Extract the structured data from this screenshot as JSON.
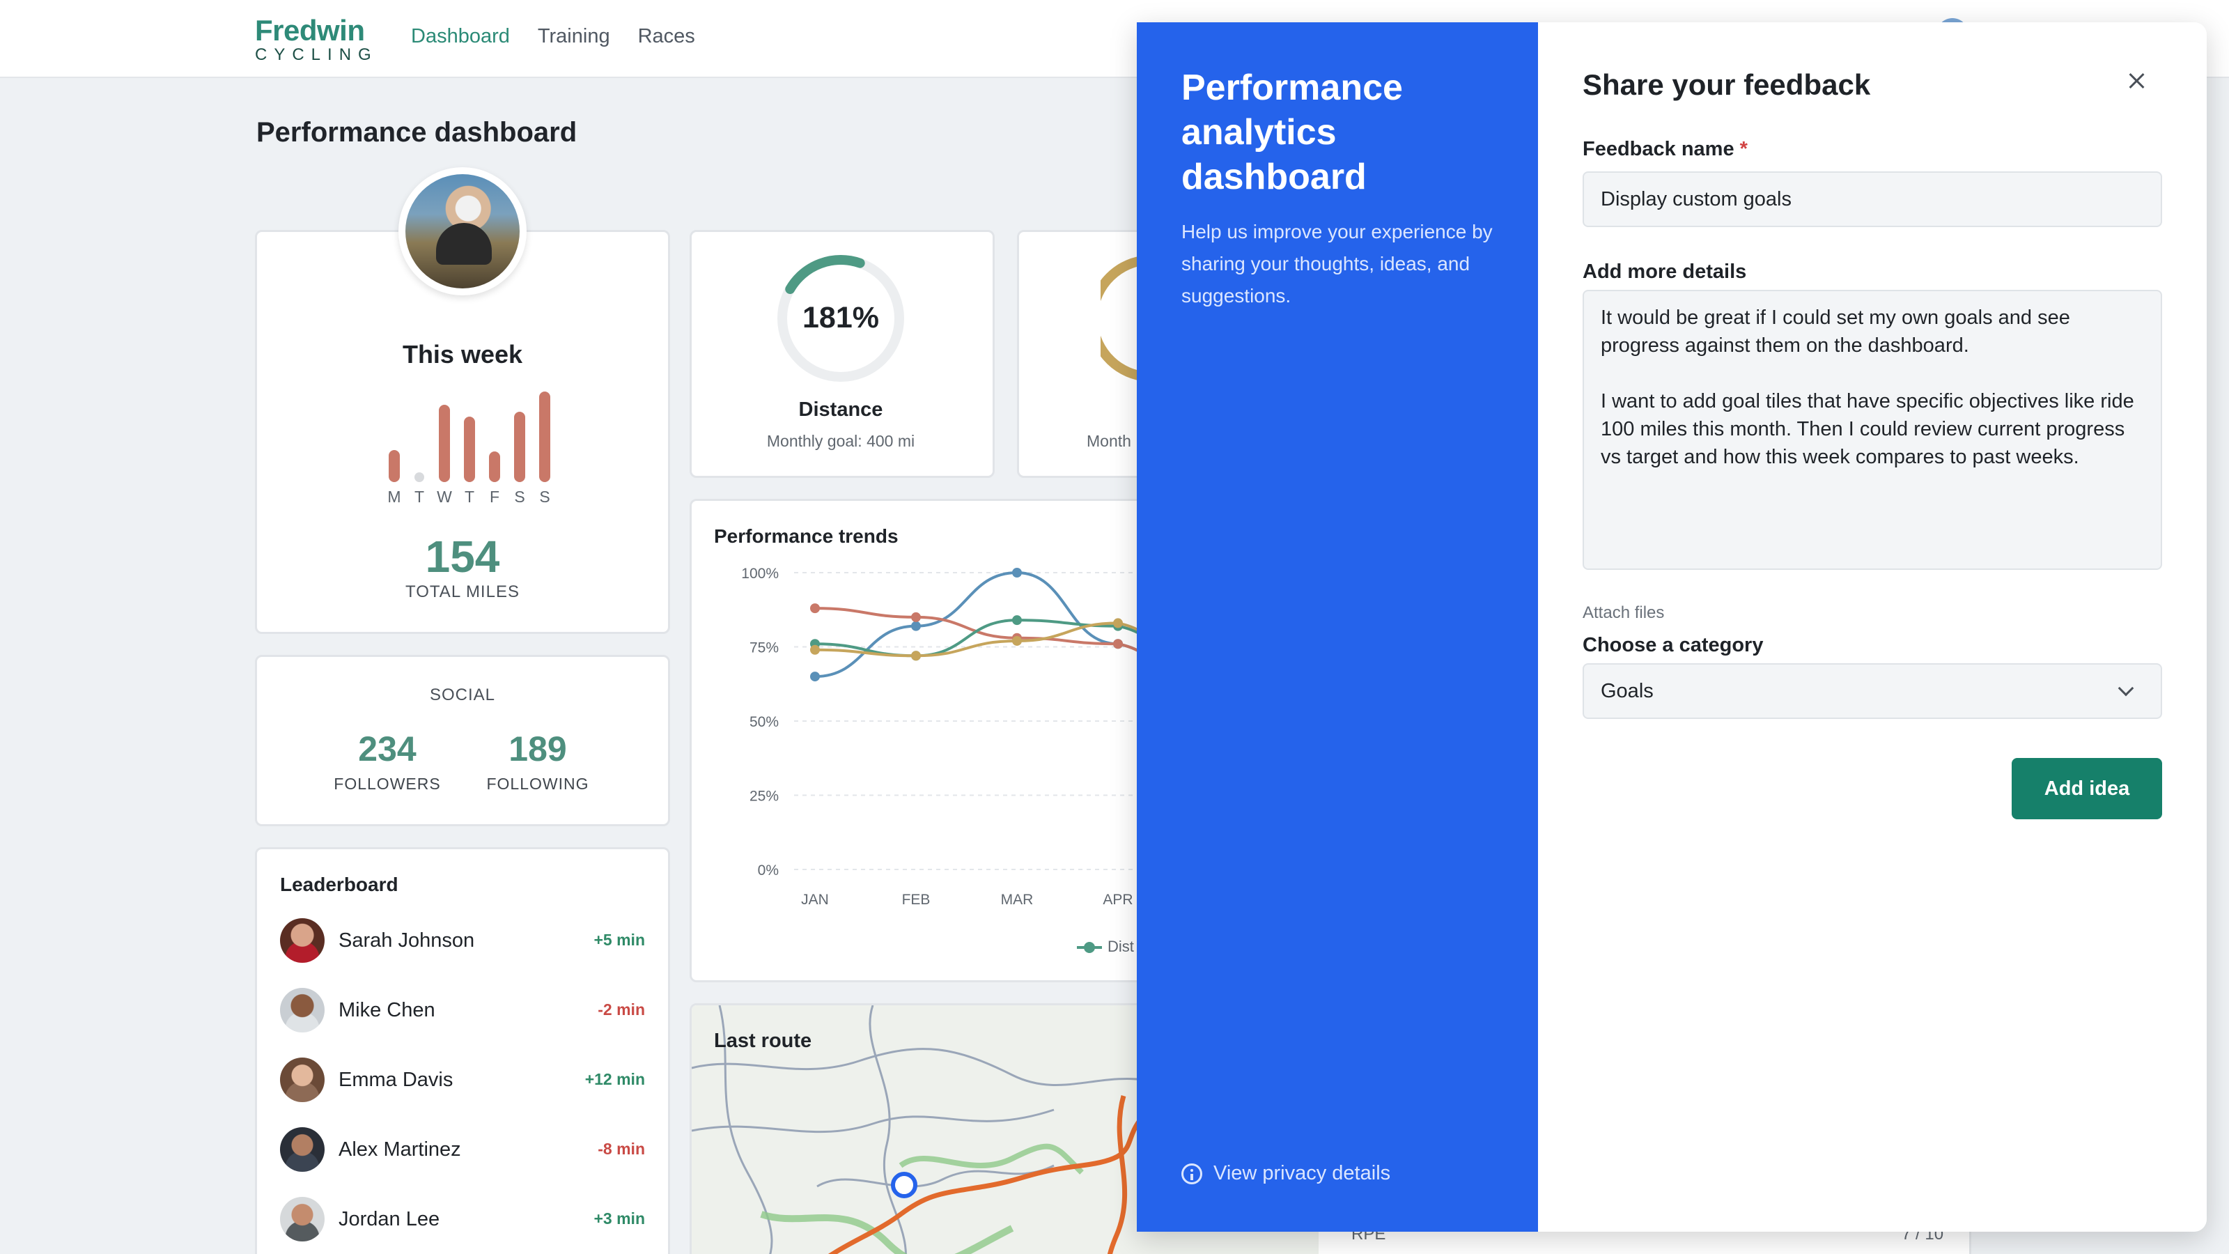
{
  "brand": {
    "name": "Fredwin",
    "sub": "CYCLING"
  },
  "nav": {
    "items": [
      {
        "label": "Dashboard",
        "active": true
      },
      {
        "label": "Training",
        "active": false
      },
      {
        "label": "Races",
        "active": false
      }
    ]
  },
  "page": {
    "title": "Performance dashboard"
  },
  "week": {
    "title": "This week",
    "days": [
      "M",
      "T",
      "W",
      "T",
      "F",
      "S",
      "S"
    ],
    "bar_values": [
      0.35,
      0,
      0.85,
      0.72,
      0.34,
      0.78,
      1.0
    ],
    "total": "154",
    "total_label": "TOTAL MILES"
  },
  "social": {
    "title": "SOCIAL",
    "followers": "234",
    "followers_label": "FOLLOWERS",
    "following": "189",
    "following_label": "FOLLOWING"
  },
  "leaderboard": {
    "title": "Leaderboard",
    "rows": [
      {
        "name": "Sarah Johnson",
        "delta": "+5 min",
        "positive": true
      },
      {
        "name": "Mike Chen",
        "delta": "-2 min",
        "positive": false
      },
      {
        "name": "Emma Davis",
        "delta": "+12 min",
        "positive": true
      },
      {
        "name": "Alex Martinez",
        "delta": "-8 min",
        "positive": false
      },
      {
        "name": "Jordan Lee",
        "delta": "+3 min",
        "positive": true
      }
    ]
  },
  "distance": {
    "percent": "181%",
    "label": "Distance",
    "sub": "Monthly goal: 400 mi",
    "progress": 1.81
  },
  "month_peek": "Month",
  "trends": {
    "title": "Performance trends",
    "legend_peek": "Dist"
  },
  "chart_data": {
    "type": "line",
    "title": "Performance trends",
    "categories": [
      "JAN",
      "FEB",
      "MAR",
      "APR"
    ],
    "yticks": [
      "0%",
      "25%",
      "50%",
      "75%",
      "100%"
    ],
    "ylim": [
      0,
      100
    ],
    "series": [
      {
        "color": "#5a90b8",
        "values": [
          65,
          82,
          100,
          76
        ]
      },
      {
        "color": "#c97868",
        "values": [
          88,
          85,
          78,
          76
        ]
      },
      {
        "color": "#4e9a84",
        "values": [
          76,
          72,
          84,
          82
        ]
      },
      {
        "color": "#c6a55c",
        "values": [
          74,
          72,
          77,
          83
        ]
      }
    ]
  },
  "route": {
    "title": "Last route",
    "rpe_label": "RPE",
    "rpe_value": "7 / 10"
  },
  "feedback": {
    "left_title": "Performance analytics dashboard",
    "left_desc": "Help us improve your experience by sharing your thoughts, ideas, and suggestions.",
    "privacy": "View privacy details",
    "title": "Share your feedback",
    "name_label": "Feedback name",
    "required_mark": "*",
    "name_value": "Display custom goals",
    "details_label": "Add more details",
    "details_value": "It would be great if I could set my own goals and see progress against them on the dashboard.\n\nI want to add goal tiles that have specific objectives like ride 100 miles this month. Then I could review current progress vs target and how this week compares to past weeks.",
    "attach": "Attach files",
    "category_label": "Choose a category",
    "category_value": "Goals",
    "submit": "Add idea"
  },
  "colors": {
    "accent": "#2b8a76",
    "panel_blue": "#2563eb",
    "button": "#16806a"
  }
}
